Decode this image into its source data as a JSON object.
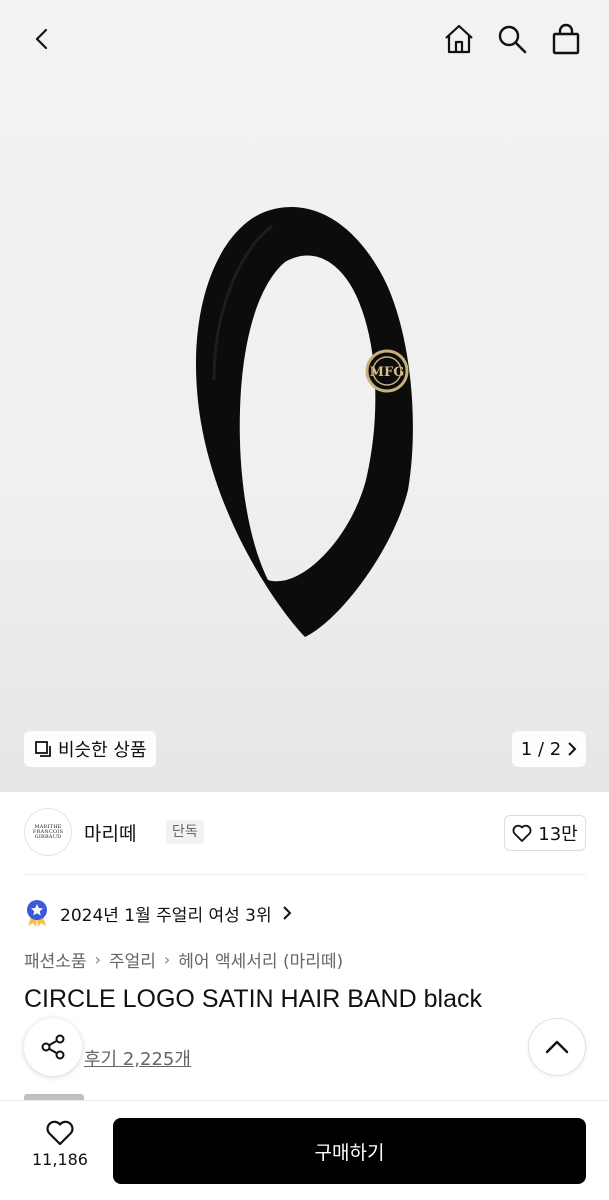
{
  "similar": {
    "label": "비슷한 상품"
  },
  "pager": {
    "label": "1 / 2"
  },
  "brand": {
    "logo_text": "MARITHE FRANCOIS GIRBAUD",
    "name": "마리떼",
    "tag": "단독",
    "likes": "13만"
  },
  "rank": {
    "text": "2024년 1월 주얼리 여성 3위"
  },
  "breadcrumb": [
    "패션소품",
    "주얼리",
    "헤어 액세서리 (마리떼)"
  ],
  "product": {
    "title": "CIRCLE LOGO SATIN HAIR BAND black",
    "reviews": "후기 2,225개"
  },
  "bottom": {
    "wish_count": "11,186",
    "buy_label": "구매하기"
  },
  "icons": [
    "back-icon",
    "home-icon",
    "search-icon",
    "shopping-bag-icon",
    "copy-icon",
    "chevron-right-icon",
    "heart-icon",
    "ranking-badge-icon",
    "share-icon",
    "chevron-up-icon"
  ],
  "colors": {
    "buy_button": "#000000",
    "badge": "#3a5bd9"
  }
}
